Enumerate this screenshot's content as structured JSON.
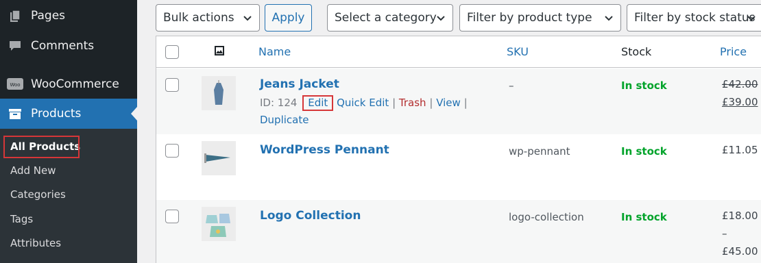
{
  "sidebar": {
    "menu": [
      {
        "label": "Pages",
        "icon": "pages-icon"
      },
      {
        "label": "Comments",
        "icon": "comments-icon"
      },
      {
        "label": "WooCommerce",
        "icon": "woocommerce-icon",
        "icon_text": "Woo"
      },
      {
        "label": "Products",
        "icon": "products-icon"
      }
    ],
    "submenu": [
      "All Products",
      "Add New",
      "Categories",
      "Tags",
      "Attributes"
    ],
    "current_submenu": "All Products"
  },
  "filters": {
    "bulk_actions": "Bulk actions",
    "apply": "Apply",
    "category": "Select a category",
    "product_type": "Filter by product type",
    "stock_status": "Filter by stock status"
  },
  "table": {
    "headers": {
      "image": "image-icon",
      "name": "Name",
      "sku": "SKU",
      "stock": "Stock",
      "price": "Price"
    },
    "rows": [
      {
        "name": "Jeans Jacket",
        "sku": "–",
        "stock": "In stock",
        "price_old": "£42.00",
        "price_new": "£39.00",
        "id_label": "ID: 124",
        "actions": {
          "edit": "Edit",
          "quick_edit": "Quick Edit",
          "trash": "Trash",
          "view": "View",
          "duplicate": "Duplicate"
        },
        "sep": "|"
      },
      {
        "name": "WordPress Pennant",
        "sku": "wp-pennant",
        "stock": "In stock",
        "price": "£11.05"
      },
      {
        "name": "Logo Collection",
        "sku": "logo-collection",
        "stock": "In stock",
        "price_line1": "£18.00 –",
        "price_line2": "£45.00"
      }
    ]
  },
  "colors": {
    "accent": "#2271b1",
    "highlight": "#d63638",
    "in_stock": "#00a32a",
    "sidebar": "#1d2327"
  }
}
